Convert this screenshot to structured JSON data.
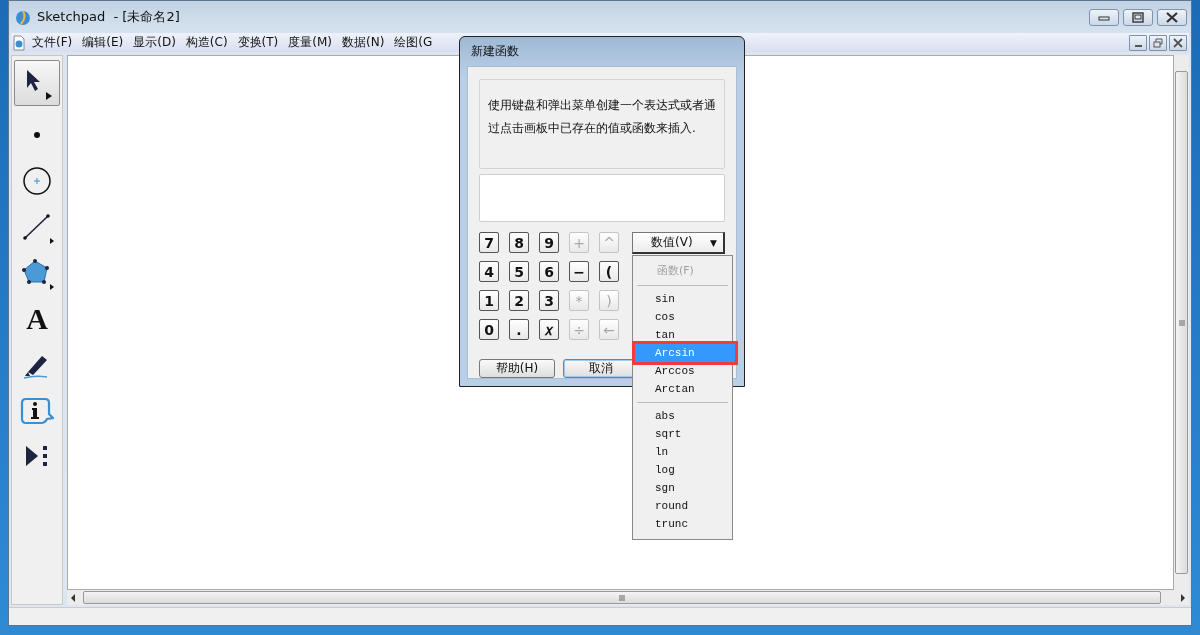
{
  "window": {
    "title": "Sketchpad  - [未命名2]"
  },
  "menubar": [
    "文件(F)",
    "编辑(E)",
    "显示(D)",
    "构造(C)",
    "变换(T)",
    "度量(M)",
    "数据(N)",
    "绘图(G"
  ],
  "tools": [
    {
      "kind": "select",
      "selected": true
    },
    {
      "kind": "point",
      "selected": false
    },
    {
      "kind": "compass",
      "selected": false
    },
    {
      "kind": "line",
      "selected": false
    },
    {
      "kind": "polygon",
      "selected": false
    },
    {
      "kind": "text",
      "label": "A",
      "selected": false
    },
    {
      "kind": "marker",
      "selected": false
    },
    {
      "kind": "info",
      "selected": false
    },
    {
      "kind": "custom",
      "selected": false
    }
  ],
  "dialog": {
    "title": "新建函数",
    "hint": "使用键盘和弹出菜单创建一个表达式或者通过点击画板中已存在的值或函数来插入.",
    "keys": [
      {
        "label": "7",
        "disabled": false
      },
      {
        "label": "8",
        "disabled": false
      },
      {
        "label": "9",
        "disabled": false
      },
      {
        "label": "+",
        "disabled": true
      },
      {
        "label": "^",
        "disabled": true
      },
      {
        "label": "4",
        "disabled": false
      },
      {
        "label": "5",
        "disabled": false
      },
      {
        "label": "6",
        "disabled": false
      },
      {
        "label": "−",
        "disabled": false
      },
      {
        "label": "(",
        "disabled": false
      },
      {
        "label": "1",
        "disabled": false
      },
      {
        "label": "2",
        "disabled": false
      },
      {
        "label": "3",
        "disabled": false
      },
      {
        "label": "*",
        "disabled": true
      },
      {
        "label": ")",
        "disabled": true
      },
      {
        "label": "0",
        "disabled": false
      },
      {
        "label": ".",
        "disabled": false
      },
      {
        "label": "𝑥",
        "disabled": false
      },
      {
        "label": "÷",
        "disabled": true
      },
      {
        "label": "←",
        "disabled": true
      }
    ],
    "dropdown": {
      "label": "数值(V)",
      "arrow": "▼"
    },
    "buttons": [
      {
        "label": "帮助(H)",
        "focused": false
      },
      {
        "label": "取消",
        "focused": true
      }
    ]
  },
  "popup_menu": {
    "header": {
      "label": "函数(F)",
      "disabled": true
    },
    "items": [
      {
        "kind": "separator"
      },
      {
        "kind": "item",
        "label": "sin",
        "selected": false,
        "highlighted": false
      },
      {
        "kind": "item",
        "label": "cos",
        "selected": false,
        "highlighted": false
      },
      {
        "kind": "item",
        "label": "tan",
        "selected": false,
        "highlighted": false
      },
      {
        "kind": "item",
        "label": "Arcsin",
        "selected": true,
        "highlighted": true
      },
      {
        "kind": "item",
        "label": "Arccos",
        "selected": false,
        "highlighted": false
      },
      {
        "kind": "item",
        "label": "Arctan",
        "selected": false,
        "highlighted": false
      },
      {
        "kind": "separator"
      },
      {
        "kind": "item",
        "label": "abs",
        "selected": false,
        "highlighted": false
      },
      {
        "kind": "item",
        "label": "sqrt",
        "selected": false,
        "highlighted": false
      },
      {
        "kind": "item",
        "label": "ln",
        "selected": false,
        "highlighted": false
      },
      {
        "kind": "item",
        "label": "log",
        "selected": false,
        "highlighted": false
      },
      {
        "kind": "item",
        "label": "sgn",
        "selected": false,
        "highlighted": false
      },
      {
        "kind": "item",
        "label": "round",
        "selected": false,
        "highlighted": false
      },
      {
        "kind": "item",
        "label": "trunc",
        "selected": false,
        "highlighted": false
      }
    ]
  }
}
